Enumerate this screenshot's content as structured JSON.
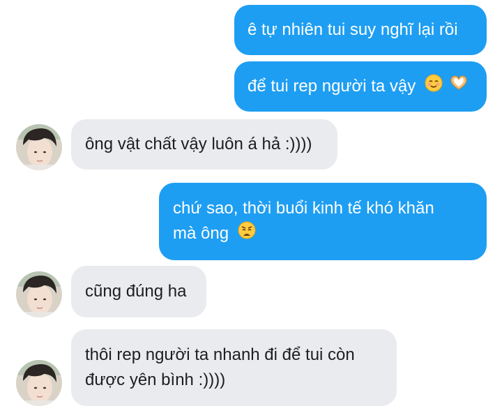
{
  "conversation": {
    "messages": [
      {
        "from": "me",
        "text": "ê tự nhiên tui suy nghĩ lại rồi"
      },
      {
        "from": "me",
        "text": "để tui rep người ta vậy",
        "emojis": [
          "smiling-face-icon",
          "heart-hands-icon"
        ]
      },
      {
        "from": "them",
        "text": "ông vật chất vậy luôn á hả :))))"
      },
      {
        "from": "me",
        "line1": "chứ sao, thời buổi kinh tế khó khăn",
        "line2": "mà ông",
        "emojis": [
          "weary-face-icon"
        ]
      },
      {
        "from": "them",
        "text": "cũng đúng ha"
      },
      {
        "from": "them",
        "line1": "thôi rep người ta nhanh đi để tui còn",
        "line2": "được yên bình :))))"
      }
    ]
  },
  "colors": {
    "sent_bubble": "#1e9ef2",
    "received_bubble": "#e9ebee",
    "sent_text": "#ffffff",
    "received_text": "#1c1e21"
  }
}
